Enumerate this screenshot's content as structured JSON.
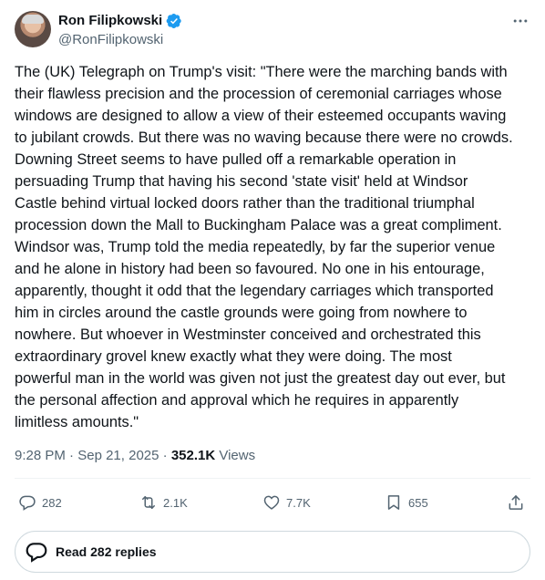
{
  "author": {
    "display_name": "Ron Filipkowski",
    "handle": "@RonFilipkowski",
    "verified": true
  },
  "tweet": {
    "text": "The (UK) Telegraph on Trump's visit: \"There were the marching bands with\ntheir flawless precision and the procession of ceremonial carriages whose\nwindows are designed to allow a view of their esteemed occupants waving\nto jubilant crowds. But there was no waving because there were no crowds.\nDowning Street seems to have pulled off a remarkable operation in\npersuading  Trump that having his second 'state visit' held at Windsor\nCastle behind virtual locked doors rather than the traditional triumphal\nprocession down the Mall to Buckingham Palace was a great compliment.\nWindsor was, Trump told the media repeatedly, by far the superior venue\nand he alone in history had been so favoured. No one in his entourage,\napparently, thought it odd that the legendary carriages which transported\nhim in circles around the castle grounds were going from nowhere to\nnowhere. But whoever in Westminster conceived and orchestrated this\nextraordinary grovel knew exactly what they were doing. The most\npowerful man in the world was given not just the greatest day out ever, but\nthe personal affection and approval which he requires in apparently\nlimitless amounts.\"",
    "time": "9:28 PM",
    "separator": " · ",
    "date": "Sep 21, 2025",
    "views_count": "352.1K",
    "views_label": " Views"
  },
  "actions": {
    "replies": "282",
    "reposts": "2.1K",
    "likes": "7.7K",
    "bookmarks": "655"
  },
  "read_replies_label": "Read 282 replies",
  "colors": {
    "verified": "#1d9bf0",
    "secondary_text": "#536471",
    "primary_text": "#0f1419",
    "border": "#cfd9de"
  }
}
